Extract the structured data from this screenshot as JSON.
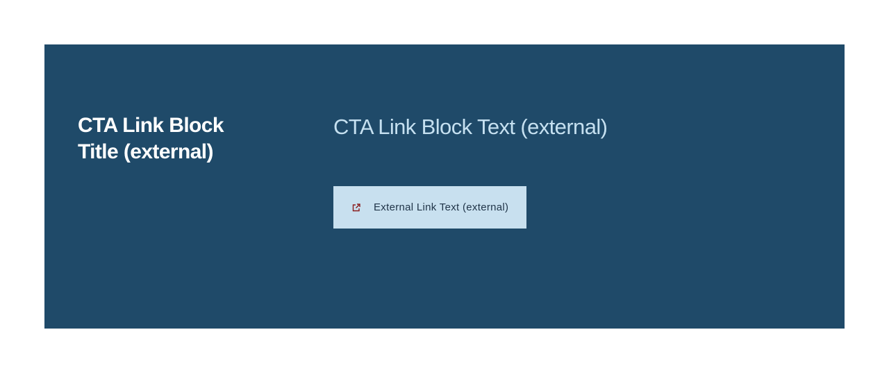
{
  "cta": {
    "title": "CTA Link Block Title (external)",
    "text": "CTA Link Block Text (external)",
    "link_label": "External Link Text (external)",
    "link_icon": "external-link-icon"
  },
  "colors": {
    "block_background": "#1f4a69",
    "title": "#ffffff",
    "text": "#c5e0f0",
    "button_background": "#c8e0ef",
    "button_text": "#1f3347",
    "icon": "#8a1c1c"
  }
}
